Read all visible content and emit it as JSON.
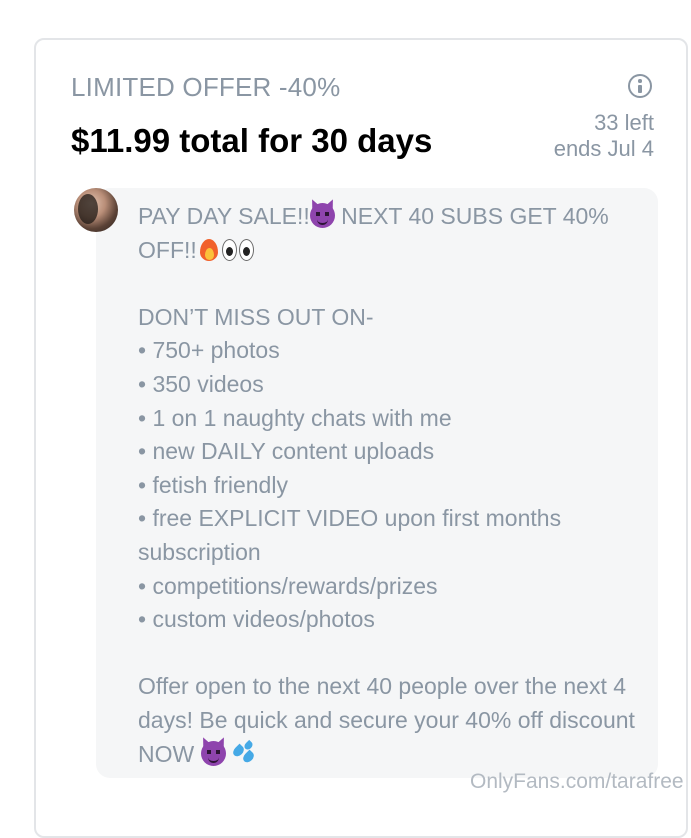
{
  "offer": {
    "label": "LIMITED OFFER -40%",
    "price_text": "$11.99 total for 30 days",
    "left_count": "33 left",
    "ends": "ends Jul 4",
    "info_icon": "info-icon"
  },
  "message": {
    "line1_a": "PAY DAY SALE!!",
    "line1_b": " NEXT 40 SUBS GET 40% OFF!!",
    "intro": "DON’T MISS OUT ON-",
    "bullets": [
      "• 750+ photos",
      "• 350 videos",
      "• 1 on 1 naughty chats with me",
      "• new DAILY content uploads",
      "• fetish friendly",
      "• free EXPLICIT VIDEO upon first months subscription",
      "• competitions/rewards/prizes",
      "• custom videos/photos"
    ],
    "closing": "Offer open to the next 40 people over the next 4 days! Be quick and secure your 40% off discount NOW ",
    "emojis": [
      "smiling-devil-emoji",
      "fire-emoji",
      "eyes-emoji",
      "sweat-droplets-emoji"
    ]
  },
  "watermark": "OnlyFans.com/tarafree",
  "colors": {
    "muted_text": "#8a96a3",
    "bubble_bg": "#f5f6f7",
    "card_border": "#e3e5e8"
  }
}
